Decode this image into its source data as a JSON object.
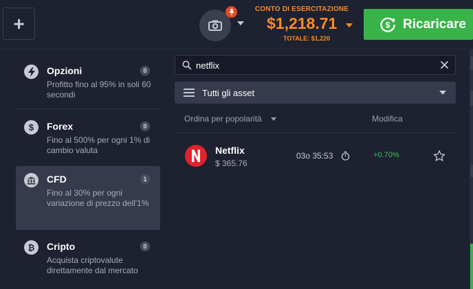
{
  "topbar": {
    "plus_label": "+",
    "account": {
      "label": "CONTO DI ESERCITAZIONE",
      "balance": "$1,218.71",
      "total": "TOTALE: $1,220"
    },
    "deposit_label": "Ricaricare",
    "icons": [
      "plus-icon",
      "camera-icon",
      "microphone-icon",
      "caret-down-icon",
      "dollar-refresh-icon"
    ]
  },
  "categories": [
    {
      "title": "Opzioni",
      "desc": "Profitto fino al 95% in soli 60 secondi",
      "count": "0",
      "icon": "lightning-icon",
      "active": false
    },
    {
      "title": "Forex",
      "desc": "Fino al 500% per ogni 1% di cambio valuta",
      "count": "0",
      "icon": "dollar-icon",
      "active": false
    },
    {
      "title": "CFD",
      "desc": "Fino al 30% per ogni variazione di prezzo dell'1%",
      "count": "1",
      "icon": "bank-icon",
      "active": true
    },
    {
      "title": "Cripto",
      "desc": "Acquista criptovalute direttamente dal mercato",
      "count": "0",
      "icon": "bitcoin-icon",
      "active": false
    }
  ],
  "search": {
    "value": "netflix",
    "placeholder": ""
  },
  "filter": {
    "selected": "Tutti gli asset"
  },
  "columns": {
    "sort_label": "Ordina per popolarità",
    "change_label": "Modifica"
  },
  "assets": [
    {
      "name": "Netflix",
      "price": "$ 365.76",
      "timer": "03o 35:53",
      "change": "+0.70%",
      "logo": "N"
    }
  ],
  "colors": {
    "background": "#1d2130",
    "accent_orange": "#ff8a1f",
    "deposit_green": "#39b349",
    "positive": "#3ac25e",
    "active_item": "#363a4b",
    "netflix_red": "#e1222c"
  }
}
